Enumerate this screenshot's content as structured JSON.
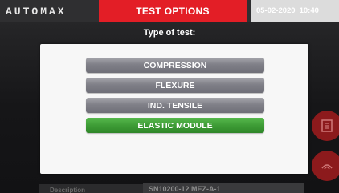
{
  "header": {
    "brand": "AUTOMAX",
    "title": "TEST OPTIONS",
    "date": "05-02-2020",
    "time": "10:40"
  },
  "dialog": {
    "heading": "Type of test:",
    "options": [
      {
        "label": "COMPRESSION",
        "selected": false
      },
      {
        "label": "FLEXURE",
        "selected": false
      },
      {
        "label": "IND. TENSILE",
        "selected": false
      },
      {
        "label": "ELASTIC MODULE",
        "selected": true
      }
    ]
  },
  "background": {
    "side_buttons": [
      "document-icon",
      "signal-icon"
    ],
    "bottom_left_label": "Description",
    "bottom_right_text": "SN10200-12 MEZ-A-1"
  },
  "colors": {
    "title_red": "#e31e26",
    "option_gray": "#808088",
    "option_selected_green": "#3e9c36",
    "dialog_bg": "#f7f7f7"
  }
}
